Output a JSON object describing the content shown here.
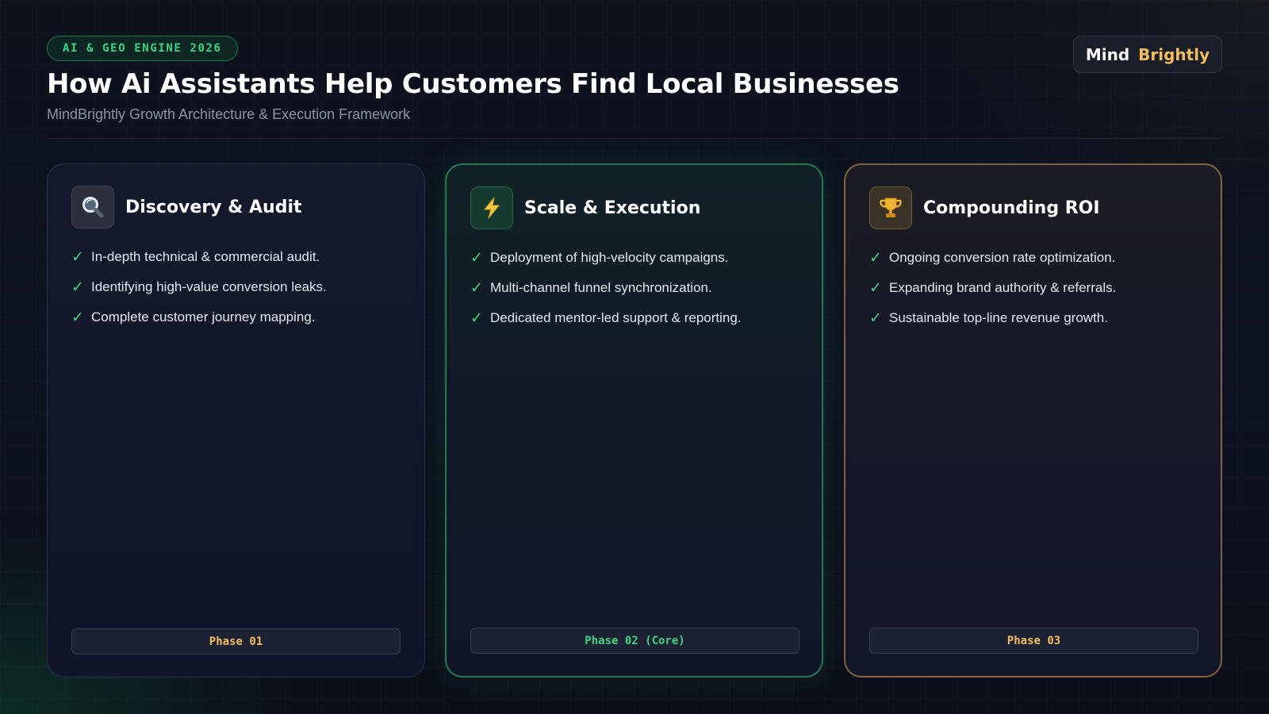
{
  "header": {
    "tag": "AI & GEO ENGINE 2026",
    "title": "How Ai Assistants Help Customers Find Local Businesses",
    "subtitle": "MindBrightly Growth Architecture & Execution Framework",
    "logo": {
      "part1": "Mind",
      "part2": "Brightly"
    }
  },
  "cards": [
    {
      "icon": "magnifying-glass-icon",
      "title": "Discovery & Audit",
      "items": [
        "In-depth technical & commercial audit.",
        "Identifying high-value conversion leaks.",
        "Complete customer journey mapping."
      ],
      "phase": "Phase 01",
      "accent": "#8a93a8"
    },
    {
      "icon": "lightning-bolt-icon",
      "title": "Scale & Execution",
      "items": [
        "Deployment of high-velocity campaigns.",
        "Multi-channel funnel synchronization.",
        "Dedicated mentor-led support & reporting."
      ],
      "phase": "Phase 02 (Core)",
      "accent": "#2fb36f"
    },
    {
      "icon": "trophy-icon",
      "title": "Compounding ROI",
      "items": [
        "Ongoing conversion rate optimization.",
        "Expanding brand authority & referrals.",
        "Sustainable top-line revenue growth."
      ],
      "phase": "Phase 03",
      "accent": "#d19a4e"
    }
  ],
  "colors": {
    "green": "#3fd483",
    "gold": "#f2bd5c",
    "background": "#0c101b"
  },
  "check_glyph": "✓"
}
